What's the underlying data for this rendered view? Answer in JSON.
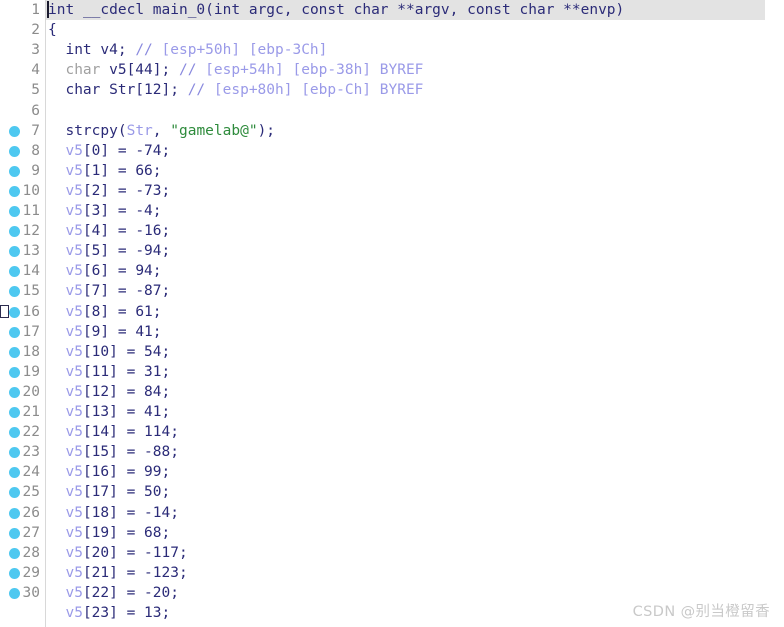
{
  "editor": {
    "app": "ida-pseudocode-view",
    "language": "c",
    "gutter_separator_color": "#d8d8d8",
    "highlight_color": "#e3e3e3",
    "breakpoint_color": "#4ec8f0",
    "background": "#ffffff"
  },
  "colors": {
    "keyword": "#2b2b78",
    "keyword_dim": "#a0a0a0",
    "variable": "#9a9ae8",
    "number": "#2b2b78",
    "string": "#2e8b3c",
    "comment": "#9a9ae8",
    "lineno": "#8c8c8c",
    "caret": "#1a1a2e"
  },
  "watermark": {
    "text": "CSDN @别当橙留香"
  },
  "lines": [
    {
      "number": "1",
      "breakpoint": false,
      "highlight": true,
      "caret": true,
      "exec_marker": false,
      "tokens": [
        {
          "c": "kw",
          "t": "int"
        },
        {
          "c": "plain",
          "t": " "
        },
        {
          "c": "kw",
          "t": "__cdecl"
        },
        {
          "c": "plain",
          "t": " "
        },
        {
          "c": "fn",
          "t": "main_0"
        },
        {
          "c": "plain",
          "t": "("
        },
        {
          "c": "kw",
          "t": "int"
        },
        {
          "c": "plain",
          "t": " argc, "
        },
        {
          "c": "kw",
          "t": "const"
        },
        {
          "c": "plain",
          "t": " "
        },
        {
          "c": "kw",
          "t": "char"
        },
        {
          "c": "plain",
          "t": " **argv, "
        },
        {
          "c": "kw",
          "t": "const"
        },
        {
          "c": "plain",
          "t": " "
        },
        {
          "c": "kw",
          "t": "char"
        },
        {
          "c": "plain",
          "t": " **envp)"
        }
      ]
    },
    {
      "number": "2",
      "breakpoint": false,
      "highlight": false,
      "caret": false,
      "exec_marker": false,
      "tokens": [
        {
          "c": "plain",
          "t": "{"
        }
      ]
    },
    {
      "number": "3",
      "breakpoint": false,
      "highlight": false,
      "caret": false,
      "exec_marker": false,
      "tokens": [
        {
          "c": "plain",
          "t": "  "
        },
        {
          "c": "kw",
          "t": "int"
        },
        {
          "c": "plain",
          "t": " v4; "
        },
        {
          "c": "cmt-s",
          "t": "//"
        },
        {
          "c": "cmt",
          "t": " [esp+50h] [ebp-3Ch]"
        }
      ]
    },
    {
      "number": "4",
      "breakpoint": false,
      "highlight": false,
      "caret": false,
      "exec_marker": false,
      "tokens": [
        {
          "c": "plain",
          "t": "  "
        },
        {
          "c": "kw-dim",
          "t": "char"
        },
        {
          "c": "plain",
          "t": " v5[44]; "
        },
        {
          "c": "cmt-s",
          "t": "//"
        },
        {
          "c": "cmt",
          "t": " [esp+54h] [ebp-38h] BYREF"
        }
      ]
    },
    {
      "number": "5",
      "breakpoint": false,
      "highlight": false,
      "caret": false,
      "exec_marker": false,
      "tokens": [
        {
          "c": "plain",
          "t": "  "
        },
        {
          "c": "kw",
          "t": "char"
        },
        {
          "c": "plain",
          "t": " Str[12]; "
        },
        {
          "c": "cmt-s",
          "t": "//"
        },
        {
          "c": "cmt",
          "t": " [esp+80h] [ebp-Ch] BYREF"
        }
      ]
    },
    {
      "number": "6",
      "breakpoint": false,
      "highlight": false,
      "caret": false,
      "exec_marker": false,
      "tokens": []
    },
    {
      "number": "7",
      "breakpoint": true,
      "highlight": false,
      "caret": false,
      "exec_marker": false,
      "tokens": [
        {
          "c": "plain",
          "t": "  "
        },
        {
          "c": "fn",
          "t": "strcpy"
        },
        {
          "c": "plain",
          "t": "("
        },
        {
          "c": "var",
          "t": "Str"
        },
        {
          "c": "plain",
          "t": ", "
        },
        {
          "c": "str",
          "t": "\"gamelab@\""
        },
        {
          "c": "plain",
          "t": ");"
        }
      ]
    },
    {
      "number": "8",
      "breakpoint": true,
      "highlight": false,
      "caret": false,
      "exec_marker": false,
      "tokens": [
        {
          "c": "plain",
          "t": "  "
        },
        {
          "c": "var",
          "t": "v5"
        },
        {
          "c": "plain",
          "t": "[0] = -74;"
        }
      ]
    },
    {
      "number": "9",
      "breakpoint": true,
      "highlight": false,
      "caret": false,
      "exec_marker": false,
      "tokens": [
        {
          "c": "plain",
          "t": "  "
        },
        {
          "c": "var",
          "t": "v5"
        },
        {
          "c": "plain",
          "t": "[1] = 66;"
        }
      ]
    },
    {
      "number": "10",
      "breakpoint": true,
      "highlight": false,
      "caret": false,
      "exec_marker": false,
      "tokens": [
        {
          "c": "plain",
          "t": "  "
        },
        {
          "c": "var",
          "t": "v5"
        },
        {
          "c": "plain",
          "t": "[2] = -73;"
        }
      ]
    },
    {
      "number": "11",
      "breakpoint": true,
      "highlight": false,
      "caret": false,
      "exec_marker": false,
      "tokens": [
        {
          "c": "plain",
          "t": "  "
        },
        {
          "c": "var",
          "t": "v5"
        },
        {
          "c": "plain",
          "t": "[3] = -4;"
        }
      ]
    },
    {
      "number": "12",
      "breakpoint": true,
      "highlight": false,
      "caret": false,
      "exec_marker": false,
      "tokens": [
        {
          "c": "plain",
          "t": "  "
        },
        {
          "c": "var",
          "t": "v5"
        },
        {
          "c": "plain",
          "t": "[4] = -16;"
        }
      ]
    },
    {
      "number": "13",
      "breakpoint": true,
      "highlight": false,
      "caret": false,
      "exec_marker": false,
      "tokens": [
        {
          "c": "plain",
          "t": "  "
        },
        {
          "c": "var",
          "t": "v5"
        },
        {
          "c": "plain",
          "t": "[5] = -94;"
        }
      ]
    },
    {
      "number": "14",
      "breakpoint": true,
      "highlight": false,
      "caret": false,
      "exec_marker": false,
      "tokens": [
        {
          "c": "plain",
          "t": "  "
        },
        {
          "c": "var",
          "t": "v5"
        },
        {
          "c": "plain",
          "t": "[6] = 94;"
        }
      ]
    },
    {
      "number": "15",
      "breakpoint": true,
      "highlight": false,
      "caret": false,
      "exec_marker": false,
      "tokens": [
        {
          "c": "plain",
          "t": "  "
        },
        {
          "c": "var",
          "t": "v5"
        },
        {
          "c": "plain",
          "t": "[7] = -87;"
        }
      ]
    },
    {
      "number": "16",
      "breakpoint": true,
      "highlight": false,
      "caret": false,
      "exec_marker": true,
      "tokens": [
        {
          "c": "plain",
          "t": "  "
        },
        {
          "c": "var",
          "t": "v5"
        },
        {
          "c": "plain",
          "t": "[8] = 61;"
        }
      ]
    },
    {
      "number": "17",
      "breakpoint": true,
      "highlight": false,
      "caret": false,
      "exec_marker": false,
      "tokens": [
        {
          "c": "plain",
          "t": "  "
        },
        {
          "c": "var",
          "t": "v5"
        },
        {
          "c": "plain",
          "t": "[9] = 41;"
        }
      ]
    },
    {
      "number": "18",
      "breakpoint": true,
      "highlight": false,
      "caret": false,
      "exec_marker": false,
      "tokens": [
        {
          "c": "plain",
          "t": "  "
        },
        {
          "c": "var",
          "t": "v5"
        },
        {
          "c": "plain",
          "t": "[10] = 54;"
        }
      ]
    },
    {
      "number": "19",
      "breakpoint": true,
      "highlight": false,
      "caret": false,
      "exec_marker": false,
      "tokens": [
        {
          "c": "plain",
          "t": "  "
        },
        {
          "c": "var",
          "t": "v5"
        },
        {
          "c": "plain",
          "t": "[11] = 31;"
        }
      ]
    },
    {
      "number": "20",
      "breakpoint": true,
      "highlight": false,
      "caret": false,
      "exec_marker": false,
      "tokens": [
        {
          "c": "plain",
          "t": "  "
        },
        {
          "c": "var",
          "t": "v5"
        },
        {
          "c": "plain",
          "t": "[12] = 84;"
        }
      ]
    },
    {
      "number": "21",
      "breakpoint": true,
      "highlight": false,
      "caret": false,
      "exec_marker": false,
      "tokens": [
        {
          "c": "plain",
          "t": "  "
        },
        {
          "c": "var",
          "t": "v5"
        },
        {
          "c": "plain",
          "t": "[13] = 41;"
        }
      ]
    },
    {
      "number": "22",
      "breakpoint": true,
      "highlight": false,
      "caret": false,
      "exec_marker": false,
      "tokens": [
        {
          "c": "plain",
          "t": "  "
        },
        {
          "c": "var",
          "t": "v5"
        },
        {
          "c": "plain",
          "t": "[14] = 114;"
        }
      ]
    },
    {
      "number": "23",
      "breakpoint": true,
      "highlight": false,
      "caret": false,
      "exec_marker": false,
      "tokens": [
        {
          "c": "plain",
          "t": "  "
        },
        {
          "c": "var",
          "t": "v5"
        },
        {
          "c": "plain",
          "t": "[15] = -88;"
        }
      ]
    },
    {
      "number": "24",
      "breakpoint": true,
      "highlight": false,
      "caret": false,
      "exec_marker": false,
      "tokens": [
        {
          "c": "plain",
          "t": "  "
        },
        {
          "c": "var",
          "t": "v5"
        },
        {
          "c": "plain",
          "t": "[16] = 99;"
        }
      ]
    },
    {
      "number": "25",
      "breakpoint": true,
      "highlight": false,
      "caret": false,
      "exec_marker": false,
      "tokens": [
        {
          "c": "plain",
          "t": "  "
        },
        {
          "c": "var",
          "t": "v5"
        },
        {
          "c": "plain",
          "t": "[17] = 50;"
        }
      ]
    },
    {
      "number": "26",
      "breakpoint": true,
      "highlight": false,
      "caret": false,
      "exec_marker": false,
      "tokens": [
        {
          "c": "plain",
          "t": "  "
        },
        {
          "c": "var",
          "t": "v5"
        },
        {
          "c": "plain",
          "t": "[18] = -14;"
        }
      ]
    },
    {
      "number": "27",
      "breakpoint": true,
      "highlight": false,
      "caret": false,
      "exec_marker": false,
      "tokens": [
        {
          "c": "plain",
          "t": "  "
        },
        {
          "c": "var",
          "t": "v5"
        },
        {
          "c": "plain",
          "t": "[19] = 68;"
        }
      ]
    },
    {
      "number": "28",
      "breakpoint": true,
      "highlight": false,
      "caret": false,
      "exec_marker": false,
      "tokens": [
        {
          "c": "plain",
          "t": "  "
        },
        {
          "c": "var",
          "t": "v5"
        },
        {
          "c": "plain",
          "t": "[20] = -117;"
        }
      ]
    },
    {
      "number": "29",
      "breakpoint": true,
      "highlight": false,
      "caret": false,
      "exec_marker": false,
      "tokens": [
        {
          "c": "plain",
          "t": "  "
        },
        {
          "c": "var",
          "t": "v5"
        },
        {
          "c": "plain",
          "t": "[21] = -123;"
        }
      ]
    },
    {
      "number": "30",
      "breakpoint": true,
      "highlight": false,
      "caret": false,
      "exec_marker": false,
      "tokens": [
        {
          "c": "plain",
          "t": "  "
        },
        {
          "c": "var",
          "t": "v5"
        },
        {
          "c": "plain",
          "t": "[22] = -20;"
        }
      ]
    },
    {
      "number": "",
      "breakpoint": false,
      "highlight": false,
      "caret": false,
      "exec_marker": false,
      "tokens": [
        {
          "c": "plain",
          "t": "  "
        },
        {
          "c": "var",
          "t": "v5"
        },
        {
          "c": "plain",
          "t": "[23] = 13;"
        }
      ]
    }
  ]
}
